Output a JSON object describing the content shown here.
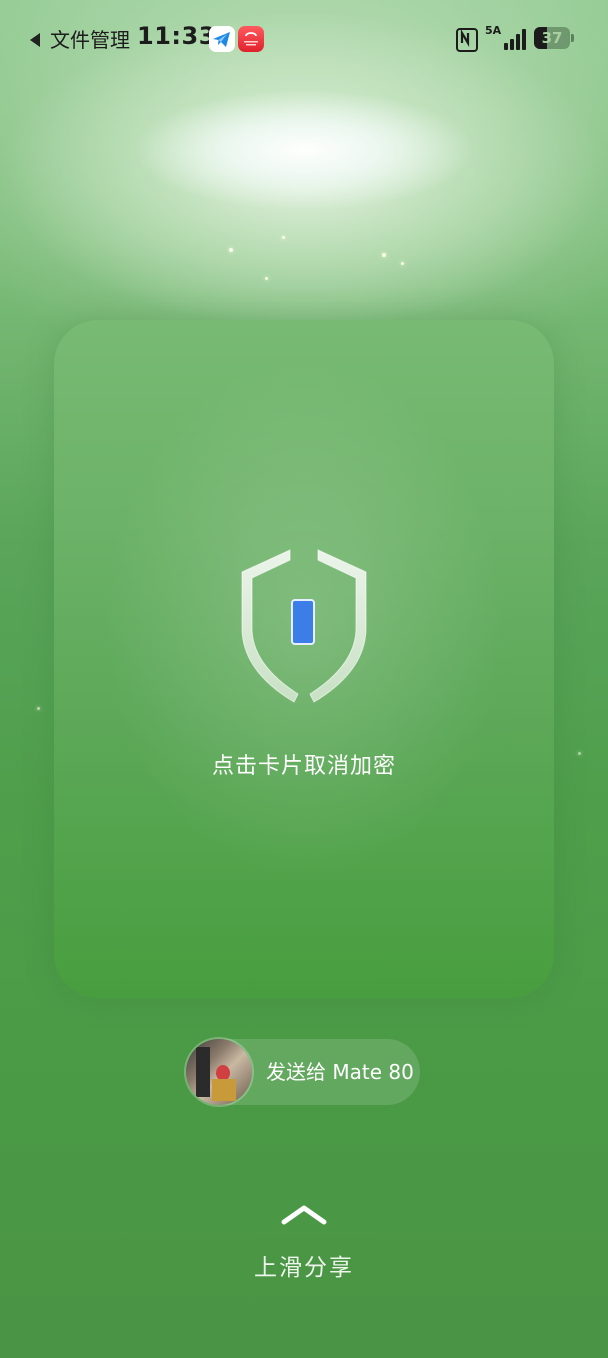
{
  "status_bar": {
    "back_app_label": "文件管理",
    "time": "11:33",
    "app_icons": [
      "telegram-like-icon",
      "gallery-app-icon"
    ],
    "nfc_icon": "nfc-icon",
    "network_label": "5A",
    "signal_icon": "signal-bars-icon",
    "battery_percent": "37",
    "battery_level": 0.37
  },
  "card": {
    "icon": "shield-lock-icon",
    "hint": "点击卡片取消加密",
    "colors": {
      "shield_outline": "#e8f0e6",
      "lock_fill": "#3d7de8"
    }
  },
  "send_to": {
    "label": "发送给 Mate 80",
    "avatar": "contact-avatar"
  },
  "swipe": {
    "icon": "chevron-up-icon",
    "label": "上滑分享"
  },
  "colors": {
    "background_top": "#8fc98f",
    "background_bottom": "#4a9445",
    "accent": "#3d7de8"
  }
}
